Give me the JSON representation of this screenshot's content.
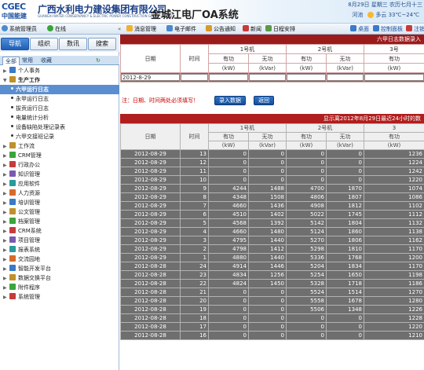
{
  "header": {
    "logo_brand": "CGEC",
    "logo_text": "中国能建",
    "company_name": "广西水利电力建设集团有限公司",
    "company_name_en": "GUANGXI WATER CONSERVANCY & ELECTRIC POWER CONSTRUCTION GROUP CO., LTD.",
    "system_name": "金城江电厂OA系统",
    "date_text": "8月29日 星期三 农历七月十三",
    "city": "河池",
    "weather": "多云 33℃~24℃"
  },
  "toolbar": {
    "user_label": "系统管理员",
    "status_label": "在线",
    "items": [
      "消息管理",
      "电子邮件",
      "公告通知",
      "新闻",
      "日程安排"
    ],
    "right_items": [
      "桌面",
      "控制面板",
      "注销"
    ]
  },
  "sidebar": {
    "nav_buttons": [
      "导航",
      "组织",
      "数讯",
      "搜索"
    ],
    "tabs": [
      "全部",
      "常用",
      "收藏"
    ],
    "items": [
      {
        "label": "个人事务",
        "level": 0
      },
      {
        "label": "生产工作",
        "level": 0
      },
      {
        "label": "六甲运行日志",
        "level": 1,
        "selected": true
      },
      {
        "label": "永甲运行日志",
        "level": 1
      },
      {
        "label": "拔贡运行日志",
        "level": 1
      },
      {
        "label": "电量统计分析",
        "level": 1
      },
      {
        "label": "设备缺陷处理记录表",
        "level": 1
      },
      {
        "label": "六甲交接班记录",
        "level": 1
      },
      {
        "label": "工作流",
        "level": 0
      },
      {
        "label": "CRM管理",
        "level": 0
      },
      {
        "label": "行政办公",
        "level": 0
      },
      {
        "label": "知识管理",
        "level": 0
      },
      {
        "label": "应用软件",
        "level": 0
      },
      {
        "label": "人力资源",
        "level": 0
      },
      {
        "label": "培训管理",
        "level": 0
      },
      {
        "label": "公文管理",
        "level": 0
      },
      {
        "label": "档案管理",
        "level": 0
      },
      {
        "label": "CRM系统",
        "level": 0
      },
      {
        "label": "项目管理",
        "level": 0
      },
      {
        "label": "报表系统",
        "level": 0
      },
      {
        "label": "交流园地",
        "level": 0
      },
      {
        "label": "智能开发平台",
        "level": 0
      },
      {
        "label": "数据交换平台",
        "level": 0
      },
      {
        "label": "附件程序",
        "level": 0
      },
      {
        "label": "系统管理",
        "level": 0
      }
    ]
  },
  "form": {
    "title": "六甲日志数据录入",
    "col_date": "日期",
    "col_time": "时间",
    "unit1": "1号机",
    "unit2": "2号机",
    "unit3": "3号",
    "active": "有功",
    "reactive": "无功",
    "kw": "(kW)",
    "kvar": "(kVar)",
    "date_value": "2012-8-29",
    "note": "注：日期、时间两处必须填写！",
    "save_button": "录入数据",
    "back_button": "返回"
  },
  "table": {
    "title": "显示离2012年8月29日最近24小时的数",
    "col_date": "日期",
    "col_time": "时间",
    "unit1": "1号机",
    "unit2": "2号机",
    "unit3": "3",
    "active": "有功",
    "reactive": "无功",
    "kw": "(kW)",
    "kvar": "(kVar)",
    "rows": [
      [
        "2012-08-29",
        "13",
        "0",
        "0",
        "0",
        "0",
        "1236"
      ],
      [
        "2012-08-29",
        "12",
        "0",
        "0",
        "0",
        "0",
        "1224"
      ],
      [
        "2012-08-29",
        "11",
        "0",
        "0",
        "0",
        "0",
        "1242"
      ],
      [
        "2012-08-29",
        "10",
        "0",
        "0",
        "0",
        "0",
        "1220"
      ],
      [
        "2012-08-29",
        "9",
        "4244",
        "1488",
        "4700",
        "1870",
        "1074"
      ],
      [
        "2012-08-29",
        "8",
        "4348",
        "1508",
        "4806",
        "1807",
        "1086"
      ],
      [
        "2012-08-29",
        "7",
        "4660",
        "1436",
        "4908",
        "1812",
        "1102"
      ],
      [
        "2012-08-29",
        "6",
        "4510",
        "1402",
        "5022",
        "1745",
        "1112"
      ],
      [
        "2012-08-29",
        "5",
        "4568",
        "1392",
        "5142",
        "1804",
        "1132"
      ],
      [
        "2012-08-29",
        "4",
        "4660",
        "1480",
        "5124",
        "1860",
        "1138"
      ],
      [
        "2012-08-29",
        "3",
        "4795",
        "1440",
        "5270",
        "1806",
        "1162"
      ],
      [
        "2012-08-29",
        "2",
        "4798",
        "1412",
        "5298",
        "1810",
        "1170"
      ],
      [
        "2012-08-29",
        "1",
        "4880",
        "1440",
        "5336",
        "1768",
        "1200"
      ],
      [
        "2012-08-28",
        "24",
        "4914",
        "1446",
        "5204",
        "1834",
        "1170"
      ],
      [
        "2012-08-28",
        "23",
        "4834",
        "1256",
        "5254",
        "1650",
        "1198"
      ],
      [
        "2012-08-28",
        "22",
        "4824",
        "1450",
        "5328",
        "1718",
        "1186"
      ],
      [
        "2012-08-28",
        "21",
        "0",
        "0",
        "5524",
        "1514",
        "1270"
      ],
      [
        "2012-08-28",
        "20",
        "0",
        "0",
        "5558",
        "1678",
        "1280"
      ],
      [
        "2012-08-28",
        "19",
        "0",
        "0",
        "5506",
        "1348",
        "1226"
      ],
      [
        "2012-08-28",
        "18",
        "0",
        "0",
        "0",
        "0",
        "1228"
      ],
      [
        "2012-08-28",
        "17",
        "0",
        "0",
        "0",
        "0",
        "1220"
      ],
      [
        "2012-08-28",
        "16",
        "0",
        "0",
        "0",
        "0",
        "1210"
      ]
    ]
  },
  "colors": {
    "form_bar": "#9b1b1b",
    "table_bar": "#b01e1e",
    "row_bg": "#6f6f6f",
    "nav_active": "#2a6bc2"
  }
}
